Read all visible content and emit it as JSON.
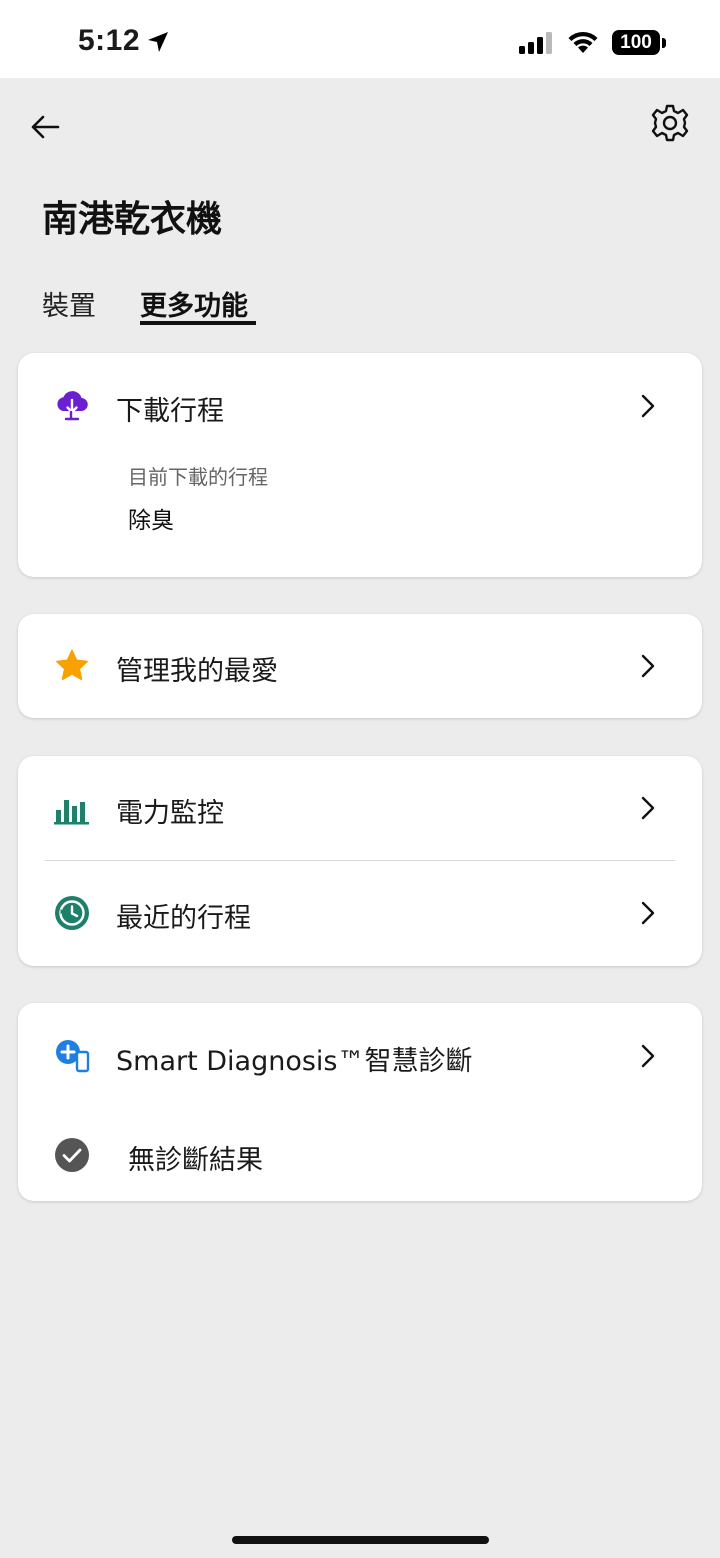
{
  "status_bar": {
    "time": "5:12",
    "battery": "100"
  },
  "header": {
    "title": "南港乾衣機"
  },
  "tabs": [
    {
      "label": "裝置",
      "active": false
    },
    {
      "label": "更多功能",
      "active": true
    }
  ],
  "download_card": {
    "label": "下載行程",
    "icon": "cloud-download-icon",
    "caption": "目前下載的行程",
    "value": "除臭"
  },
  "favorites_card": {
    "label": "管理我的最愛",
    "icon": "star-icon"
  },
  "monitor_card": {
    "items": [
      {
        "label": "電力監控",
        "icon": "bar-chart-icon"
      },
      {
        "label": "最近的行程",
        "icon": "history-clock-icon"
      }
    ]
  },
  "diagnosis_card": {
    "label": "Smart Diagnosis™智慧診斷",
    "icon": "smart-diagnosis-icon",
    "result": "無診斷結果",
    "result_icon": "check-circle-icon"
  },
  "colors": {
    "background": "#ececec",
    "card": "#ffffff",
    "download_purple": "#6b1fd1",
    "star_orange": "#f7a200",
    "chart_green": "#1e7f6b",
    "diagnosis_blue": "#1f7fe0",
    "check_gray": "#555555"
  }
}
